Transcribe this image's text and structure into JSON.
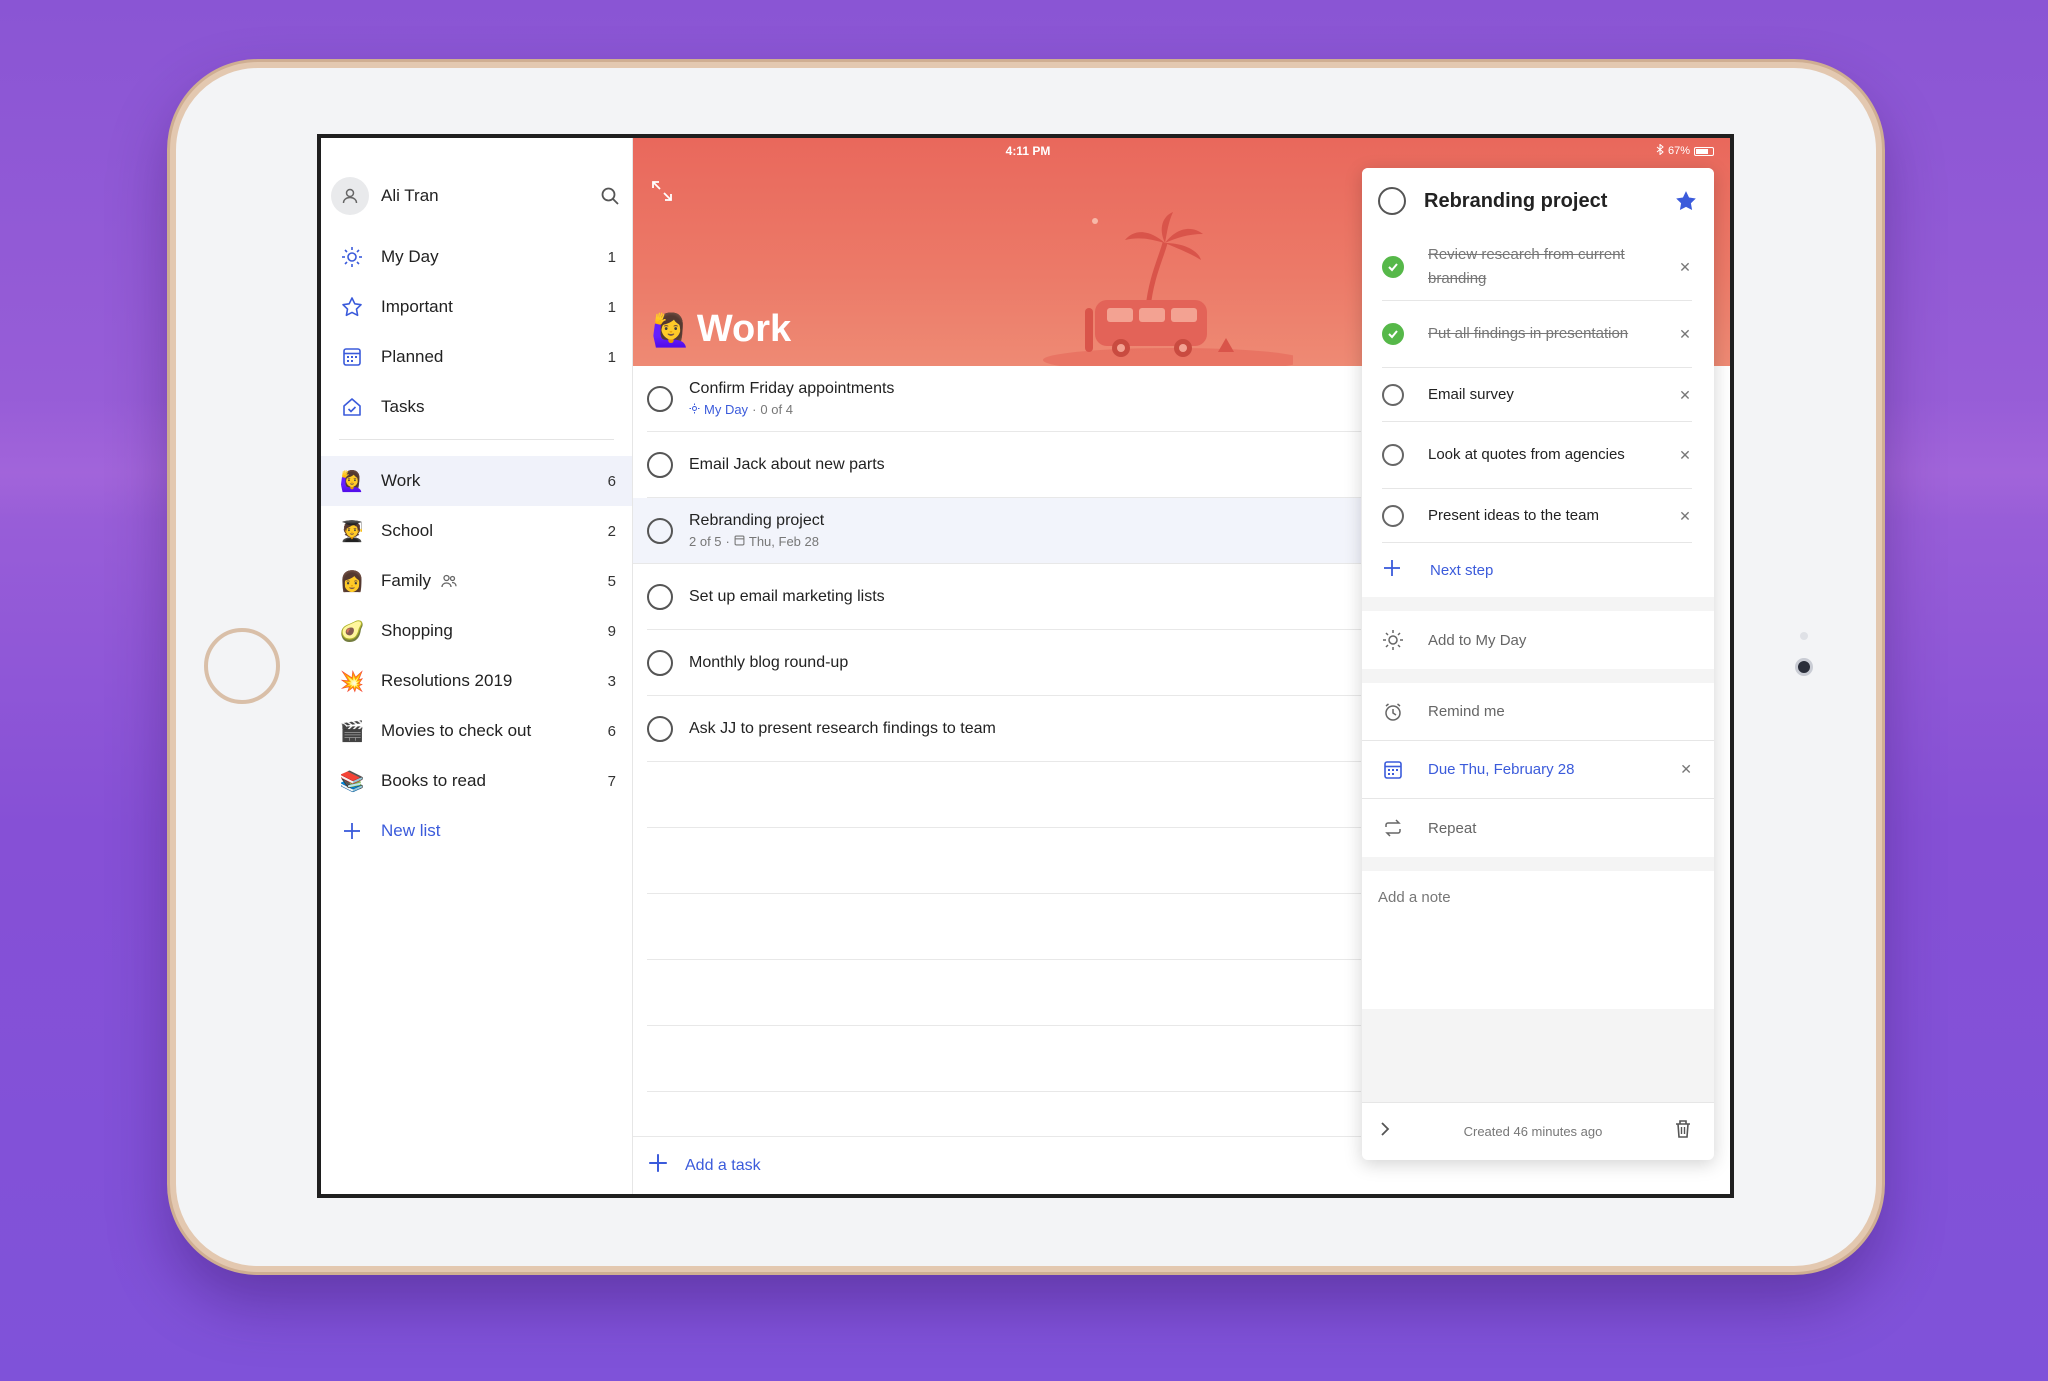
{
  "status_bar": {
    "time": "4:11 PM",
    "battery": "67%"
  },
  "sidebar": {
    "user_name": "Ali Tran",
    "smart_lists": [
      {
        "label": "My Day",
        "count": "1",
        "icon": "sun-icon"
      },
      {
        "label": "Important",
        "count": "1",
        "icon": "star-icon"
      },
      {
        "label": "Planned",
        "count": "1",
        "icon": "calendar-icon"
      },
      {
        "label": "Tasks",
        "count": "",
        "icon": "home-icon"
      }
    ],
    "lists": [
      {
        "label": "Work",
        "count": "6",
        "emoji": "🙋‍♀️"
      },
      {
        "label": "School",
        "count": "2",
        "emoji": "🧑‍🎓"
      },
      {
        "label": "Family",
        "count": "5",
        "emoji": "👩"
      },
      {
        "label": "Shopping",
        "count": "9",
        "emoji": "🥑"
      },
      {
        "label": "Resolutions 2019",
        "count": "3",
        "emoji": "💥"
      },
      {
        "label": "Movies to check out",
        "count": "6",
        "emoji": "🎬"
      },
      {
        "label": "Books to read",
        "count": "7",
        "emoji": "📚"
      }
    ],
    "new_list_label": "New list"
  },
  "main": {
    "list_title": "Work",
    "list_emoji": "🙋‍♀️",
    "tasks": [
      {
        "title": "Confirm Friday appointments",
        "sub_myday": "My Day",
        "sub_text": "0 of 4"
      },
      {
        "title": "Email Jack about new parts"
      },
      {
        "title": "Rebranding project",
        "sub_text": "2 of 5",
        "sub_date": "Thu, Feb 28"
      },
      {
        "title": "Set up email marketing lists"
      },
      {
        "title": "Monthly blog round-up"
      },
      {
        "title": "Ask JJ to present research findings to team"
      }
    ],
    "add_task_label": "Add a task"
  },
  "detail": {
    "title": "Rebranding project",
    "steps": [
      {
        "text": "Review research from current branding",
        "done": true
      },
      {
        "text": "Put all findings in presentation",
        "done": true
      },
      {
        "text": "Email survey",
        "done": false
      },
      {
        "text": "Look at quotes from agencies",
        "done": false
      },
      {
        "text": "Present ideas to the team",
        "done": false
      }
    ],
    "next_step_label": "Next step",
    "add_to_my_day": "Add to My Day",
    "remind_me": "Remind me",
    "due": "Due Thu, February 28",
    "repeat": "Repeat",
    "note_placeholder": "Add a note",
    "created": "Created 46 minutes ago"
  },
  "colors": {
    "accent": "#3b5bdb",
    "banner": "#ea6e60",
    "check": "#56b849",
    "background": "#8a55d4"
  }
}
